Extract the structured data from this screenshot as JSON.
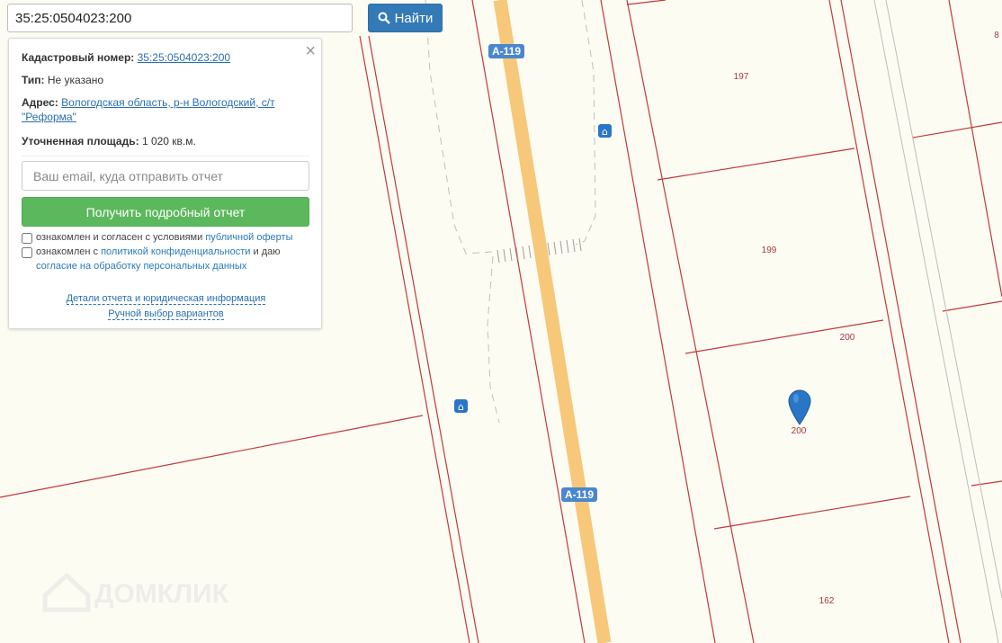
{
  "search": {
    "value": "35:25:0504023:200",
    "button_label": "Найти"
  },
  "info": {
    "cadastral_label": "Кадастровый номер:",
    "cadastral_value": "35:25:0504023:200",
    "type_label": "Тип:",
    "type_value": "Не указано",
    "address_label": "Адрес:",
    "address_line1": "Вологодская область, р-н Вологодский, с/т",
    "address_line2": "\"Реформа\"",
    "area_label": "Уточненная площадь:",
    "area_value": "1 020 кв.м."
  },
  "report": {
    "email_placeholder": "Ваш email, куда отправить отчет",
    "button_label": "Получить подробный отчет",
    "consent1_text": "ознакомлен и согласен с условиями ",
    "consent1_link": "публичной оферты",
    "consent2_text_a": "ознакомлен с ",
    "consent2_link": "политикой конфиденциальности",
    "consent2_text_b": " и даю",
    "consent2_link2": "согласие на обработку персональных данных",
    "details_link": "Детали отчета и юридическая информация",
    "manual_link": "Ручной выбор вариантов"
  },
  "map": {
    "road_label": "А-119",
    "parcel_labels": [
      "197",
      "199",
      "200",
      "200",
      "162",
      "8"
    ],
    "marker_label": "200",
    "bus_stop_glyph": "⌂",
    "watermark": "ДОМКЛИК",
    "colors": {
      "background": "#fdfcf3",
      "parcel_border": "#c0393b",
      "road": "#f7c87a",
      "road_shield": "#4a87cf",
      "marker": "#2a76c6"
    }
  }
}
